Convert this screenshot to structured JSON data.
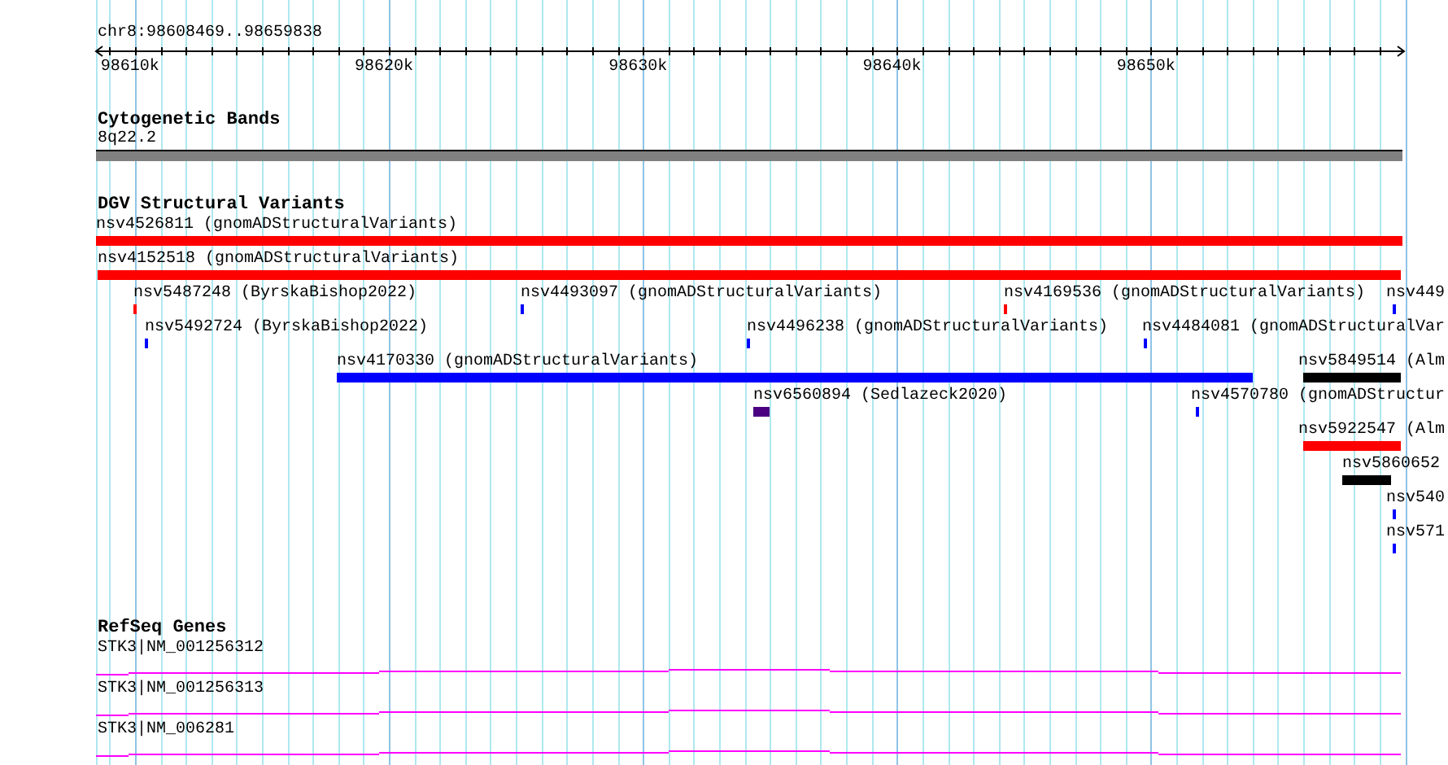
{
  "ruler": {
    "region": "chr8:98608469..98659838",
    "ticks": [
      "98610k",
      "98620k",
      "98630k",
      "98640k",
      "98650k"
    ]
  },
  "cytogenetic_bands": {
    "title": "Cytogenetic Bands",
    "bands": [
      {
        "label": "8q22.2",
        "color": "#808080"
      }
    ]
  },
  "dgv": {
    "title": "DGV Structural Variants",
    "variants": [
      {
        "label": "nsv4526811 (gnomADStructuralVariants)",
        "color": "#ff0000"
      },
      {
        "label": "nsv4152518 (gnomADStructuralVariants)",
        "color": "#ff0000"
      },
      {
        "label": "nsv5487248 (ByrskaBishop2022)",
        "color": "#ff0000"
      },
      {
        "label": "nsv4493097 (gnomADStructuralVariants)",
        "color": "#0000ff"
      },
      {
        "label": "nsv4169536 (gnomADStructuralVariants)",
        "color": "#ff0000"
      },
      {
        "label": "nsv449",
        "color": "#0000ff"
      },
      {
        "label": "nsv5492724 (ByrskaBishop2022)",
        "color": "#0000ff"
      },
      {
        "label": "nsv4496238 (gnomADStructuralVariants)",
        "color": "#0000ff"
      },
      {
        "label": "nsv4484081 (gnomADStructuralVar",
        "color": "#0000ff"
      },
      {
        "label": "nsv4170330 (gnomADStructuralVariants)",
        "color": "#0000ff"
      },
      {
        "label": "nsv5849514 (Alm",
        "color": "#000000"
      },
      {
        "label": "nsv6560894 (Sedlazeck2020)",
        "color": "#4b0082"
      },
      {
        "label": "nsv4570780 (gnomADStructur",
        "color": "#0000ff"
      },
      {
        "label": "nsv5922547 (Alm",
        "color": "#ff0000"
      },
      {
        "label": "nsv5860652",
        "color": "#000000"
      },
      {
        "label": "nsv540",
        "color": "#0000ff"
      },
      {
        "label": "nsv571",
        "color": "#0000ff"
      }
    ]
  },
  "refseq_genes": {
    "title": "RefSeq Genes",
    "genes": [
      {
        "label": "STK3|NM_001256312"
      },
      {
        "label": "STK3|NM_001256313"
      },
      {
        "label": "STK3|NM_006281"
      }
    ]
  }
}
